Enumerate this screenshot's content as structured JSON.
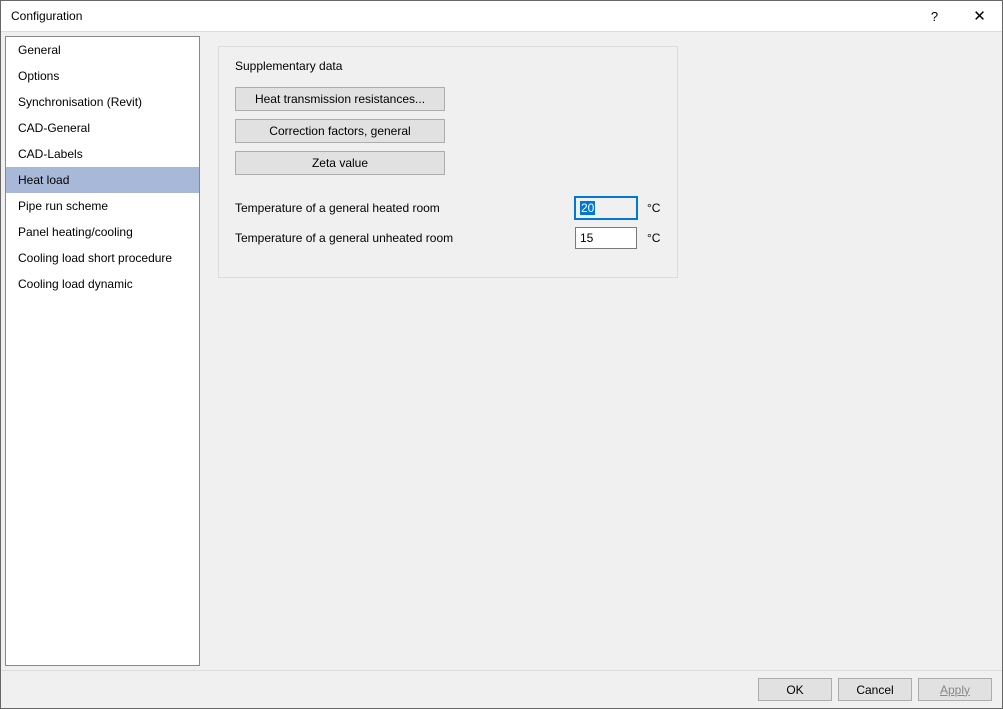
{
  "title": "Configuration",
  "titlebar": {
    "help": "?",
    "close": "✕"
  },
  "sidebar": {
    "items": [
      {
        "label": "General"
      },
      {
        "label": "Options"
      },
      {
        "label": "Synchronisation (Revit)"
      },
      {
        "label": "CAD-General"
      },
      {
        "label": "CAD-Labels"
      },
      {
        "label": "Heat load",
        "selected": true
      },
      {
        "label": "Pipe run scheme"
      },
      {
        "label": "Panel heating/cooling"
      },
      {
        "label": "Cooling load short procedure"
      },
      {
        "label": "Cooling load dynamic"
      }
    ]
  },
  "main": {
    "group_title": "Supplementary data",
    "buttons": {
      "heat_resist": "Heat transmission resistances...",
      "corr_factors": "Correction factors, general",
      "zeta": "Zeta value"
    },
    "fields": {
      "heated": {
        "label": "Temperature of a general heated room",
        "value": "20",
        "unit": "°C"
      },
      "unheated": {
        "label": "Temperature of a general unheated room",
        "value": "15",
        "unit": "°C"
      }
    }
  },
  "footer": {
    "ok": "OK",
    "cancel": "Cancel",
    "apply": "Apply"
  }
}
